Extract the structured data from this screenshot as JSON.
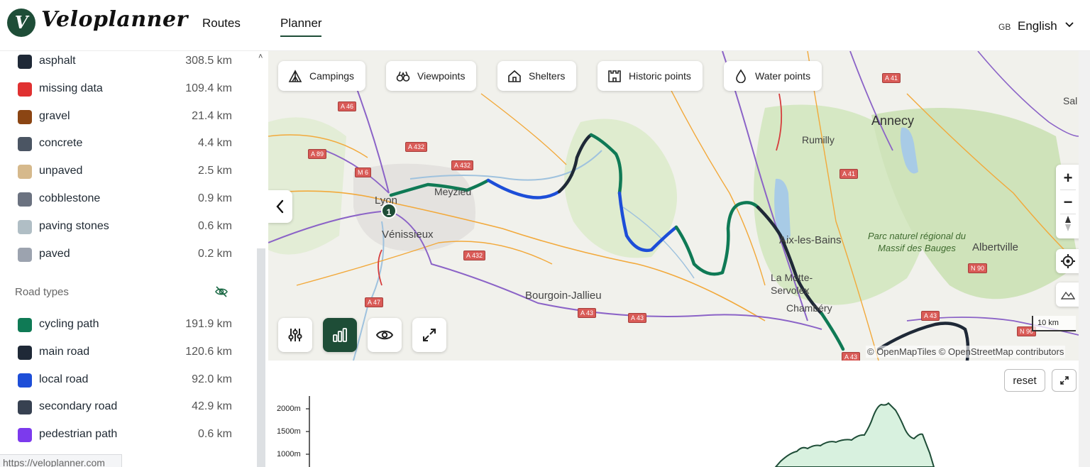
{
  "header": {
    "logo_letter": "V",
    "logo_text": "Veloplanner",
    "nav": [
      {
        "label": "Routes"
      },
      {
        "label": "Planner",
        "active": true
      }
    ],
    "language": {
      "code": "GB",
      "label": "English"
    }
  },
  "sidebar": {
    "surface_types": [
      {
        "label": "asphalt",
        "value": "308.5 km",
        "color": "#1f2937"
      },
      {
        "label": "missing data",
        "value": "109.4 km",
        "color": "#e03131"
      },
      {
        "label": "gravel",
        "value": "21.4 km",
        "color": "#8b4513"
      },
      {
        "label": "concrete",
        "value": "4.4 km",
        "color": "#4b5563"
      },
      {
        "label": "unpaved",
        "value": "2.5 km",
        "color": "#d6b98c"
      },
      {
        "label": "cobblestone",
        "value": "0.9 km",
        "color": "#6b7280"
      },
      {
        "label": "paving stones",
        "value": "0.6 km",
        "color": "#b0bec5"
      },
      {
        "label": "paved",
        "value": "0.2 km",
        "color": "#9ca3af"
      }
    ],
    "road_types_title": "Road types",
    "road_types": [
      {
        "label": "cycling path",
        "value": "191.9 km",
        "color": "#0f7a55"
      },
      {
        "label": "main road",
        "value": "120.6 km",
        "color": "#1f2937"
      },
      {
        "label": "local road",
        "value": "92.0 km",
        "color": "#1d4ed8"
      },
      {
        "label": "secondary road",
        "value": "42.9 km",
        "color": "#374151"
      },
      {
        "label": "pedestrian path",
        "value": "0.6 km",
        "color": "#7c3aed"
      }
    ],
    "status_url": "https://veloplanner.com"
  },
  "map": {
    "poi_buttons": [
      {
        "label": "Campings",
        "icon": "tent-icon"
      },
      {
        "label": "Viewpoints",
        "icon": "binoculars-icon"
      },
      {
        "label": "Shelters",
        "icon": "shelter-icon"
      },
      {
        "label": "Historic points",
        "icon": "castle-icon"
      },
      {
        "label": "Water points",
        "icon": "water-drop-icon"
      }
    ],
    "place_labels": [
      "Lyon",
      "Meyzieu",
      "Vénissieux",
      "Bourgoin-Jallieu",
      "Annecy",
      "Rumilly",
      "Aix-les-Bains",
      "La Motte-Servolex",
      "Chambéry",
      "Albertville",
      "Parc naturel régional du Massif des Bauges",
      "Sal"
    ],
    "road_labels": [
      "A 46",
      "A 89",
      "A 432",
      "A 432",
      "M 6",
      "A 432",
      "A 47",
      "A 43",
      "A 43",
      "A 41",
      "A 41",
      "A 43",
      "N 90",
      "N 90",
      "A 43"
    ],
    "start_marker": "1",
    "scale_label": "10 km",
    "attribution": "© OpenMapTiles © OpenStreetMap contributors",
    "zoom_in": "+",
    "zoom_out": "−"
  },
  "elevation": {
    "reset_label": "reset",
    "y_ticks": [
      "2000m",
      "1500m",
      "1000m"
    ]
  }
}
